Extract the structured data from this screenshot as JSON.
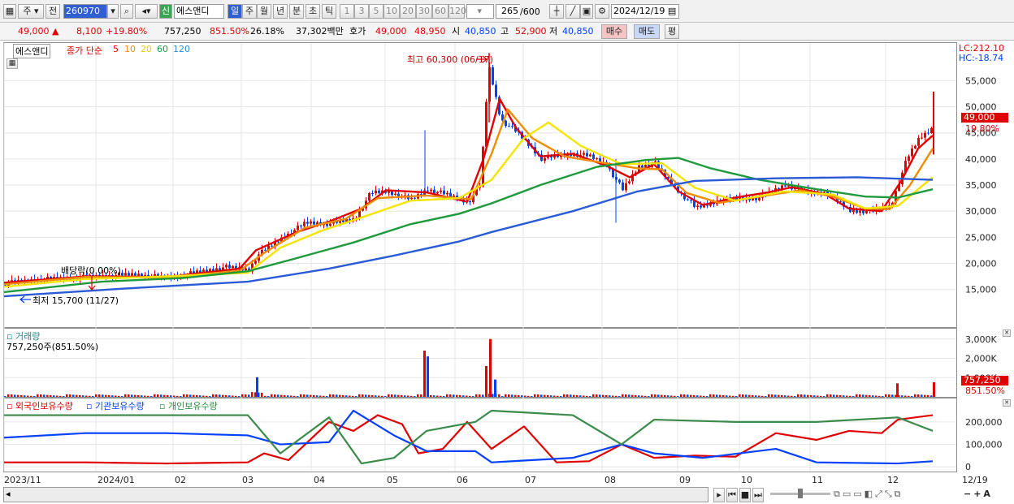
{
  "toolbar": {
    "market": "주",
    "prev": "전",
    "code": "260970",
    "new_badge": "신",
    "name": "에스앤디",
    "periods": [
      "일",
      "주",
      "월",
      "년",
      "분",
      "초",
      "틱"
    ],
    "minutes": [
      "1",
      "3",
      "5",
      "10",
      "20",
      "30",
      "60",
      "120"
    ],
    "count": "265",
    "count_total": "/600",
    "date": "2024/12/19"
  },
  "quote": {
    "price": "49,000 ▲",
    "change": "8,100",
    "change_pct": "+19.80%",
    "volume": "757,250",
    "vol_pct": "851.50%",
    "turnover": "26.18%",
    "amount": "37,302백만",
    "bid_label": "호가",
    "ask": "49,000",
    "bid": "48,950",
    "open_label": "시",
    "open": "40,850",
    "high_label": "고",
    "high": "52,900",
    "low_label": "저",
    "low": "40,850",
    "buy": "매수",
    "sell": "매도",
    "eval": "평"
  },
  "price_panel": {
    "name": "에스앤디",
    "legend_prefix": "종가 단순",
    "ma": [
      "5",
      "10",
      "20",
      "60",
      "120"
    ],
    "high_note": "최고 60,300 (06/17)",
    "low_note": "최저 15,700 (11/27)",
    "dividend_note": "배당락(0.00%)",
    "lc": "LC:212.10",
    "hc": "HC:-18.74",
    "last_tag": "49,000",
    "last_pct": "19.80%"
  },
  "volume_panel": {
    "title": "거래량",
    "info": "757,250주(851.50%)",
    "last_tag": "757,250",
    "last_pct": "851.50%"
  },
  "holding_panel": {
    "series": [
      "외국인보유수량",
      "기관보유수량",
      "개인보유수량"
    ]
  },
  "colors": {
    "up": "#e00000",
    "down": "#0040ff",
    "ma5": "#e00000",
    "ma10": "#f08c00",
    "ma20": "#f5e400",
    "ma60": "#1e9a3c",
    "ma120": "#2a5bd7"
  },
  "chart_data": [
    {
      "type": "candlestick",
      "title": "에스앤디",
      "y_ticks": [
        "55,000",
        "50,000",
        "45,000",
        "40,000",
        "35,000",
        "30,000",
        "25,000",
        "20,000",
        "15,000"
      ],
      "ylim": [
        12000,
        60500
      ],
      "x_labels": [
        "2023/11",
        "2024/01",
        "02",
        "03",
        "04",
        "05",
        "06",
        "07",
        "08",
        "09",
        "10",
        "11",
        "12",
        "12/19"
      ],
      "series": [
        {
          "name": "종가",
          "values": [
            [
              0,
              16200
            ],
            [
              40,
              16900
            ],
            [
              80,
              17200
            ],
            [
              120,
              17600
            ],
            [
              160,
              17900
            ],
            [
              200,
              17200
            ],
            [
              240,
              18400
            ],
            [
              270,
              19300
            ],
            [
              300,
              18800
            ],
            [
              310,
              21500
            ],
            [
              340,
              24800
            ],
            [
              370,
              27800
            ],
            [
              400,
              27600
            ],
            [
              430,
              28500
            ],
            [
              450,
              33500
            ],
            [
              470,
              33800
            ],
            [
              500,
              32200
            ],
            [
              520,
              34200
            ],
            [
              545,
              33100
            ],
            [
              570,
              31700
            ],
            [
              585,
              35100
            ],
            [
              595,
              58000
            ],
            [
              610,
              47500
            ],
            [
              630,
              45100
            ],
            [
              660,
              40100
            ],
            [
              700,
              41000
            ],
            [
              720,
              40500
            ],
            [
              740,
              38900
            ],
            [
              760,
              34100
            ],
            [
              780,
              38600
            ],
            [
              800,
              39100
            ],
            [
              820,
              35200
            ],
            [
              850,
              30600
            ],
            [
              880,
              32100
            ],
            [
              910,
              32400
            ],
            [
              930,
              32600
            ],
            [
              960,
              35100
            ],
            [
              990,
              33400
            ],
            [
              1010,
              33600
            ],
            [
              1040,
              30100
            ],
            [
              1070,
              30000
            ],
            [
              1090,
              31100
            ],
            [
              1110,
              40100
            ],
            [
              1125,
              44000
            ],
            [
              1140,
              45800
            ],
            [
              1143,
              49000
            ]
          ]
        },
        {
          "name": "5",
          "values": [
            [
              0,
              16300
            ],
            [
              100,
              17500
            ],
            [
              200,
              17400
            ],
            [
              290,
              19000
            ],
            [
              310,
              22500
            ],
            [
              360,
              26000
            ],
            [
              400,
              28000
            ],
            [
              440,
              30500
            ],
            [
              470,
              34000
            ],
            [
              520,
              33600
            ],
            [
              570,
              31800
            ],
            [
              590,
              40000
            ],
            [
              610,
              51500
            ],
            [
              630,
              46000
            ],
            [
              660,
              40500
            ],
            [
              700,
              41000
            ],
            [
              740,
              38800
            ],
            [
              770,
              36500
            ],
            [
              800,
              39000
            ],
            [
              830,
              33800
            ],
            [
              860,
              31200
            ],
            [
              900,
              32600
            ],
            [
              940,
              33600
            ],
            [
              970,
              34600
            ],
            [
              1010,
              33300
            ],
            [
              1040,
              30500
            ],
            [
              1080,
              30000
            ],
            [
              1105,
              36000
            ],
            [
              1125,
              42000
            ],
            [
              1143,
              44500
            ]
          ]
        },
        {
          "name": "10",
          "values": [
            [
              0,
              16000
            ],
            [
              100,
              17400
            ],
            [
              200,
              17300
            ],
            [
              290,
              18600
            ],
            [
              320,
              22000
            ],
            [
              370,
              26800
            ],
            [
              420,
              28500
            ],
            [
              460,
              32500
            ],
            [
              520,
              33000
            ],
            [
              575,
              32300
            ],
            [
              600,
              41000
            ],
            [
              620,
              49500
            ],
            [
              650,
              44000
            ],
            [
              690,
              40500
            ],
            [
              740,
              39200
            ],
            [
              780,
              38200
            ],
            [
              810,
              38000
            ],
            [
              840,
              33500
            ],
            [
              880,
              31600
            ],
            [
              930,
              32800
            ],
            [
              980,
              34000
            ],
            [
              1020,
              32800
            ],
            [
              1060,
              30500
            ],
            [
              1090,
              30400
            ],
            [
              1115,
              35000
            ],
            [
              1143,
              42000
            ]
          ]
        },
        {
          "name": "20",
          "values": [
            [
              0,
              15500
            ],
            [
              100,
              17000
            ],
            [
              200,
              17500
            ],
            [
              300,
              18200
            ],
            [
              340,
              23000
            ],
            [
              390,
              26200
            ],
            [
              440,
              28800
            ],
            [
              500,
              32000
            ],
            [
              560,
              32500
            ],
            [
              600,
              36000
            ],
            [
              640,
              44000
            ],
            [
              670,
              47000
            ],
            [
              710,
              42500
            ],
            [
              760,
              39000
            ],
            [
              810,
              39200
            ],
            [
              850,
              34500
            ],
            [
              900,
              32000
            ],
            [
              960,
              33800
            ],
            [
              1020,
              33200
            ],
            [
              1060,
              30500
            ],
            [
              1100,
              31000
            ],
            [
              1143,
              36500
            ]
          ]
        },
        {
          "name": "60",
          "values": [
            [
              0,
              14500
            ],
            [
              120,
              16500
            ],
            [
              220,
              17200
            ],
            [
              300,
              18500
            ],
            [
              360,
              21000
            ],
            [
              430,
              24000
            ],
            [
              500,
              27500
            ],
            [
              560,
              29500
            ],
            [
              600,
              31500
            ],
            [
              660,
              35000
            ],
            [
              730,
              38500
            ],
            [
              790,
              39800
            ],
            [
              830,
              40200
            ],
            [
              870,
              38200
            ],
            [
              930,
              36000
            ],
            [
              1000,
              34200
            ],
            [
              1060,
              32800
            ],
            [
              1100,
              32600
            ],
            [
              1143,
              34200
            ]
          ]
        },
        {
          "name": "120",
          "values": [
            [
              0,
              13700
            ],
            [
              150,
              15200
            ],
            [
              300,
              16500
            ],
            [
              400,
              19000
            ],
            [
              480,
              21500
            ],
            [
              560,
              24200
            ],
            [
              600,
              26000
            ],
            [
              700,
              30000
            ],
            [
              780,
              33800
            ],
            [
              850,
              35800
            ],
            [
              950,
              36300
            ],
            [
              1050,
              36500
            ],
            [
              1143,
              36000
            ]
          ]
        }
      ]
    },
    {
      "type": "bar",
      "title": "거래량",
      "y_ticks": [
        "3,000K",
        "2,000K",
        "1,000K"
      ],
      "ylim": [
        0,
        3200
      ],
      "values": [
        {
          "x": 310,
          "v": 1020
        },
        {
          "x": 516,
          "v": 2400
        },
        {
          "x": 520,
          "v": 2100
        },
        {
          "x": 592,
          "v": 1600
        },
        {
          "x": 597,
          "v": 3000
        },
        {
          "x": 603,
          "v": 900
        },
        {
          "x": 1098,
          "v": 700
        },
        {
          "x": 1143,
          "v": 757
        }
      ]
    },
    {
      "type": "line",
      "title": "보유수량",
      "y_ticks": [
        "200,000",
        "100,000",
        "0"
      ],
      "ylim": [
        -10000,
        250000
      ],
      "series": [
        {
          "name": "외국인보유수량",
          "values": [
            [
              0,
              20000
            ],
            [
              100,
              20000
            ],
            [
              200,
              15000
            ],
            [
              300,
              20000
            ],
            [
              320,
              60000
            ],
            [
              350,
              30000
            ],
            [
              400,
              200000
            ],
            [
              430,
              160000
            ],
            [
              460,
              230000
            ],
            [
              490,
              190000
            ],
            [
              510,
              60000
            ],
            [
              540,
              80000
            ],
            [
              570,
              200000
            ],
            [
              600,
              80000
            ],
            [
              640,
              180000
            ],
            [
              680,
              20000
            ],
            [
              720,
              25000
            ],
            [
              760,
              100000
            ],
            [
              800,
              40000
            ],
            [
              850,
              50000
            ],
            [
              900,
              45000
            ],
            [
              950,
              150000
            ],
            [
              1000,
              120000
            ],
            [
              1040,
              160000
            ],
            [
              1080,
              150000
            ],
            [
              1100,
              210000
            ],
            [
              1143,
              230000
            ]
          ]
        },
        {
          "name": "기관보유수량",
          "values": [
            [
              0,
              130000
            ],
            [
              100,
              150000
            ],
            [
              200,
              150000
            ],
            [
              300,
              140000
            ],
            [
              340,
              100000
            ],
            [
              400,
              110000
            ],
            [
              430,
              250000
            ],
            [
              480,
              140000
            ],
            [
              520,
              70000
            ],
            [
              580,
              70000
            ],
            [
              600,
              20000
            ],
            [
              700,
              40000
            ],
            [
              760,
              100000
            ],
            [
              800,
              60000
            ],
            [
              860,
              40000
            ],
            [
              950,
              80000
            ],
            [
              1000,
              20000
            ],
            [
              1100,
              15000
            ],
            [
              1143,
              25000
            ]
          ]
        },
        {
          "name": "개인보유수량",
          "values": [
            [
              0,
              230000
            ],
            [
              100,
              230000
            ],
            [
              200,
              230000
            ],
            [
              300,
              230000
            ],
            [
              340,
              60000
            ],
            [
              400,
              220000
            ],
            [
              440,
              15000
            ],
            [
              480,
              40000
            ],
            [
              520,
              160000
            ],
            [
              580,
              200000
            ],
            [
              600,
              250000
            ],
            [
              700,
              230000
            ],
            [
              760,
              100000
            ],
            [
              800,
              210000
            ],
            [
              900,
              200000
            ],
            [
              1000,
              200000
            ],
            [
              1100,
              220000
            ],
            [
              1143,
              160000
            ]
          ]
        }
      ]
    }
  ]
}
